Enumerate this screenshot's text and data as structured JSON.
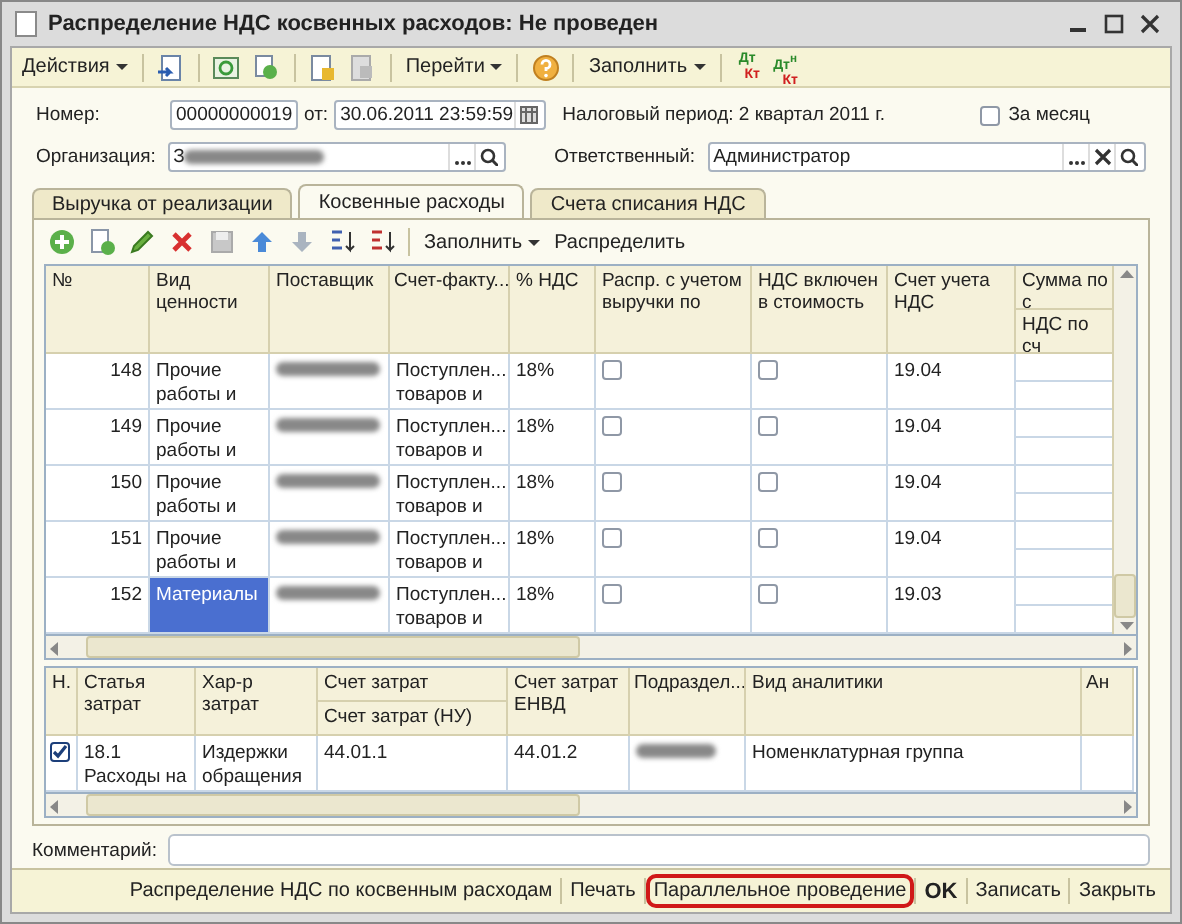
{
  "window": {
    "title": "Распределение НДС косвенных расходов: Не проведен"
  },
  "toolbar": {
    "actions_menu": "Действия",
    "goto_menu": "Перейти",
    "fill_menu": "Заполнить",
    "posting_buttons": [
      {
        "debit": "Дт",
        "credit": "Кт"
      },
      {
        "debit": "Дт",
        "credit": "Кт",
        "tax": "н"
      }
    ]
  },
  "header": {
    "number_label": "Номер:",
    "number": "00000000019",
    "date_label": "от:",
    "date": "30.06.2011 23:59:59",
    "tax_period": "Налоговый период: 2 квартал 2011 г.",
    "monthly": {
      "label": "За месяц",
      "checked": false
    },
    "organization_label": "Организация:",
    "organization": "З",
    "responsible_label": "Ответственный:",
    "responsible": "Администратор"
  },
  "tabs": [
    {
      "label": "Выручка от реализации",
      "selected": false
    },
    {
      "label": "Косвенные расходы",
      "selected": true
    },
    {
      "label": "Счета списания НДС",
      "selected": false
    }
  ],
  "table_toolbar": {
    "fill_menu": "Заполнить",
    "distribute": "Распределить"
  },
  "table": {
    "columns": [
      {
        "label": "№"
      },
      {
        "label": "Вид ценности"
      },
      {
        "label": "Поставщик"
      },
      {
        "label": "Счет-факту..."
      },
      {
        "label": "% НДС"
      },
      {
        "label": "Распр. с учетом выручки по"
      },
      {
        "label": "НДС включен в стоимость"
      },
      {
        "label": "Счет учета НДС"
      },
      {
        "label": "Сумма по с",
        "sublabel": "НДС по сч"
      }
    ],
    "rows": [
      {
        "number": "148",
        "type": "Прочие работы и",
        "invoice": "Поступлен... товаров и",
        "vat_rate": "18%",
        "by_revenue": false,
        "vat_in_cost": false,
        "account": "19.04",
        "selected": false
      },
      {
        "number": "149",
        "type": "Прочие работы и",
        "invoice": "Поступлен... товаров и",
        "vat_rate": "18%",
        "by_revenue": false,
        "vat_in_cost": false,
        "account": "19.04",
        "selected": false
      },
      {
        "number": "150",
        "type": "Прочие работы и",
        "invoice": "Поступлен... товаров и",
        "vat_rate": "18%",
        "by_revenue": false,
        "vat_in_cost": false,
        "account": "19.04",
        "selected": false
      },
      {
        "number": "151",
        "type": "Прочие работы и",
        "invoice": "Поступлен... товаров и",
        "vat_rate": "18%",
        "by_revenue": false,
        "vat_in_cost": false,
        "account": "19.04",
        "selected": false
      },
      {
        "number": "152",
        "type": "Материалы",
        "invoice": "Поступлен... товаров и",
        "vat_rate": "18%",
        "by_revenue": false,
        "vat_in_cost": false,
        "account": "19.03",
        "selected": true
      }
    ]
  },
  "cost_table": {
    "columns": [
      {
        "label": "Н."
      },
      {
        "label": "Статья затрат"
      },
      {
        "label": "Хар-р затрат"
      },
      {
        "label": "Счет затрат",
        "sublabel": "Счет затрат (НУ)"
      },
      {
        "label": "Счет затрат ЕНВД"
      },
      {
        "label": "Подраздел..."
      },
      {
        "label": "Вид аналитики"
      },
      {
        "label": "Ан"
      }
    ],
    "rows": [
      {
        "checked": true,
        "item": "18.1 Расходы на",
        "nature": "Издержки обращения",
        "account": "44.01.1",
        "envd_account": "44.01.2",
        "analytics": "Номенклатурная группа"
      }
    ]
  },
  "comment": {
    "label": "Комментарий:"
  },
  "footer": [
    {
      "label": "Распределение НДС по косвенным расходам",
      "kind": "link",
      "highlighted": false
    },
    {
      "label": "Печать",
      "kind": "link",
      "highlighted": false
    },
    {
      "label": "Параллельное проведение",
      "kind": "link",
      "highlighted": true
    },
    {
      "label": "OK",
      "kind": "default",
      "highlighted": false
    },
    {
      "label": "Записать",
      "kind": "link",
      "highlighted": false
    },
    {
      "label": "Закрыть",
      "kind": "link",
      "highlighted": false
    }
  ]
}
